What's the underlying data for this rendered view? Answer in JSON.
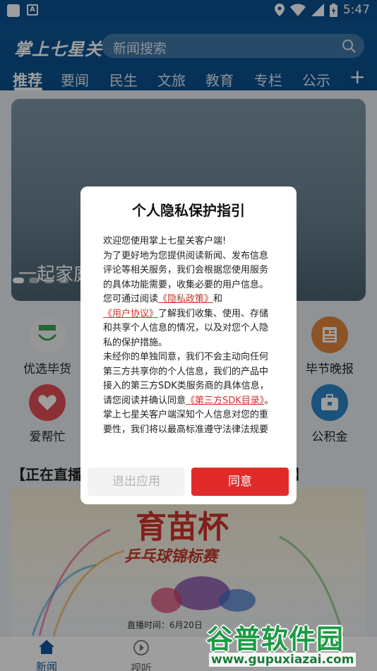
{
  "status_bar": {
    "time": "5:47"
  },
  "header": {
    "logo": "掌上七星关",
    "search_placeholder": "新闻搜索",
    "tabs": [
      "推荐",
      "要闻",
      "民生",
      "文旅",
      "教育",
      "专栏",
      "公示"
    ],
    "add_symbol": "+"
  },
  "banner": {
    "caption": "一起家庭"
  },
  "quick_icons": {
    "youxuan": "优选毕货",
    "bijie_wanbao": "毕节晚报",
    "aibangmang": "爱帮忙",
    "gongjijin": "公积金"
  },
  "live": {
    "title": "【正在直播",
    "title_right": "】",
    "poster_title": "育苗杯",
    "poster_subtitle": "乒乓球锦标赛",
    "poster_time": "直播时间：6月20日"
  },
  "bottom_nav": {
    "news": "新闻",
    "video": "视听"
  },
  "watermark": {
    "text": "谷普软件园",
    "url": "www.gupuxiazai.com"
  },
  "dialog": {
    "title": "个人隐私保护指引",
    "p1": "欢迎您使用掌上七星关客户端!",
    "p2a": "为了更好地为您提供阅读新闻、发布信息评论等相关服务，我们会根据您使用服务的具体功能需要，收集必要的用户信息。您可通过阅读",
    "link_privacy": "《隐私政策》",
    "p2b": "和",
    "link_user": "《用户协议》",
    "p2c": "了解我们收集、使用、存储和共享个人信息的情况，以及对您个人隐私的保护措施。",
    "p3a": "未经你的单独同意，我们不会主动向任何第三方共享你的个人信息，我们的产品中接入的第三方SDK类服务商的具体信息，请您阅读并确认同意",
    "link_sdk": "《第三方SDK目录》",
    "p3b": "。",
    "p4": "掌上七星关客户端深知个人信息对您的重要性，我们将以最高标准遵守法律法规要",
    "btn_exit": "退出应用",
    "btn_agree": "同意"
  },
  "colors": {
    "brand": "#0b4f8f",
    "accent": "#e12b2b",
    "link": "#d3302a"
  }
}
